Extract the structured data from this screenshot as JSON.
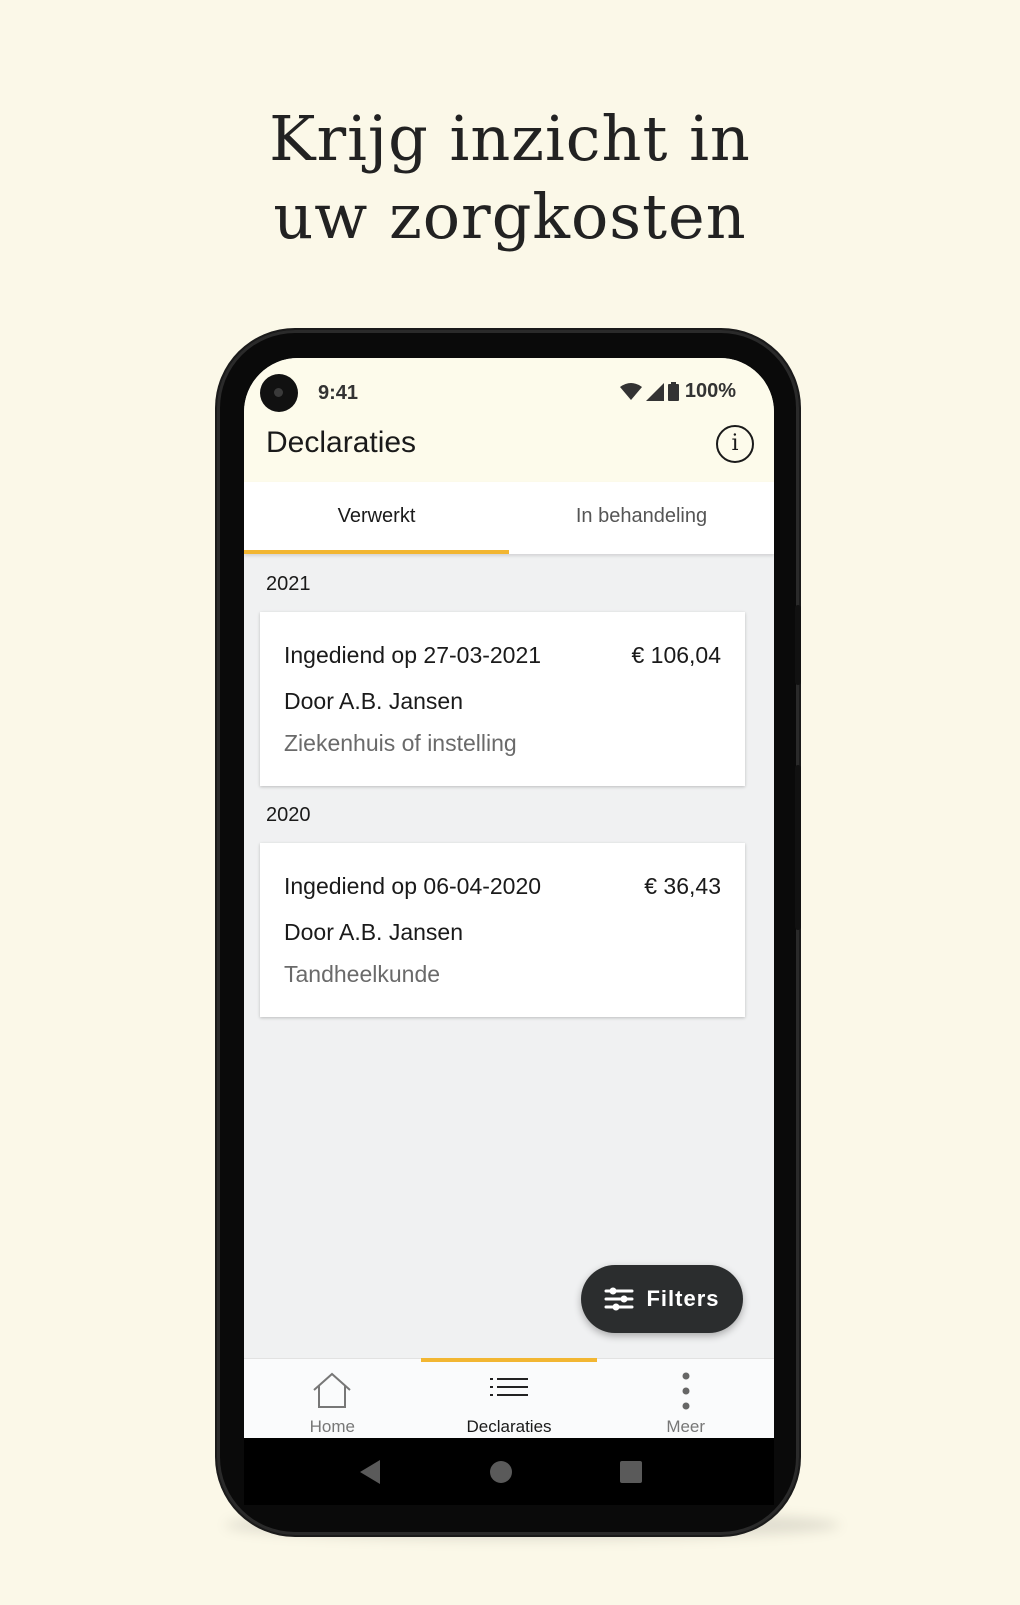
{
  "headline": {
    "line1": "Krijg inzicht in",
    "line2": "uw zorgkosten"
  },
  "status_bar": {
    "time": "9:41",
    "battery": "100%",
    "icons": [
      "wifi-icon",
      "signal-icon",
      "battery-icon"
    ]
  },
  "app_bar": {
    "title": "Declaraties",
    "info_icon": "info-icon",
    "info_glyph": "i"
  },
  "tabs": [
    {
      "label": "Verwerkt",
      "active": true
    },
    {
      "label": "In behandeling",
      "active": false
    }
  ],
  "groups": [
    {
      "year": "2021",
      "claims": [
        {
          "submitted": "Ingediend op 27-03-2021",
          "amount": "€ 106,04",
          "by": "Door A.B. Jansen",
          "category": "Ziekenhuis of instelling"
        }
      ]
    },
    {
      "year": "2020",
      "claims": [
        {
          "submitted": "Ingediend op 06-04-2020",
          "amount": "€ 36,43",
          "by": "Door A.B. Jansen",
          "category": "Tandheelkunde"
        }
      ]
    }
  ],
  "fab": {
    "label": "Filters",
    "icon": "filter-sliders-icon"
  },
  "bottom_nav": [
    {
      "label": "Home",
      "icon": "home-icon",
      "active": false
    },
    {
      "label": "Declaraties",
      "icon": "list-icon",
      "active": true
    },
    {
      "label": "Meer",
      "icon": "more-vertical-icon",
      "active": false
    }
  ],
  "system_nav": [
    "back-icon",
    "home-circle-icon",
    "recents-icon"
  ],
  "colors": {
    "background": "#fbf8e8",
    "accent": "#f2b632",
    "fab": "#2b2d2e"
  }
}
